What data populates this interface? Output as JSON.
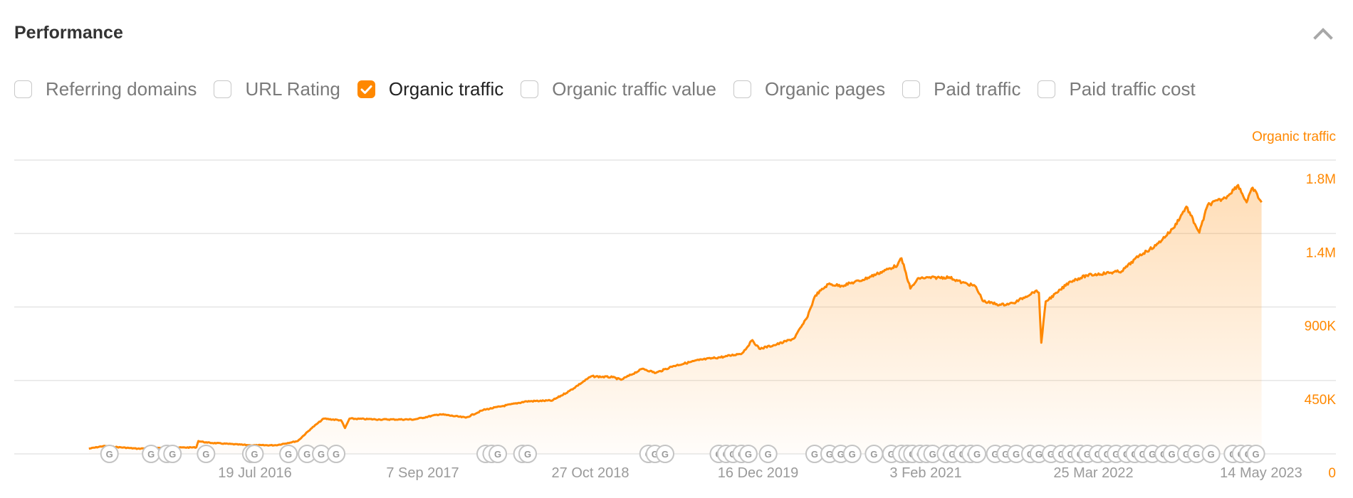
{
  "header": {
    "title": "Performance",
    "collapse_icon": "chevron-up-icon"
  },
  "metrics": [
    {
      "label": "Referring domains",
      "checked": false
    },
    {
      "label": "URL Rating",
      "checked": false
    },
    {
      "label": "Organic traffic",
      "checked": true
    },
    {
      "label": "Organic traffic value",
      "checked": false
    },
    {
      "label": "Organic pages",
      "checked": false
    },
    {
      "label": "Paid traffic",
      "checked": false
    },
    {
      "label": "Paid traffic cost",
      "checked": false
    }
  ],
  "colors": {
    "accent": "#ff8800",
    "grid": "#e6e6e6",
    "axis_text": "#9a9a9a"
  },
  "chart_data": {
    "type": "area",
    "title": "",
    "series_label": "Organic traffic",
    "ylabel": "Organic traffic",
    "y_axis_position": "right",
    "ylim": [
      0,
      1800000
    ],
    "y_ticks": [
      {
        "value": 1800000,
        "label": "1.8M"
      },
      {
        "value": 1350000,
        "label": "1.4M"
      },
      {
        "value": 900000,
        "label": "900K"
      },
      {
        "value": 450000,
        "label": "450K"
      },
      {
        "value": 0,
        "label": "0"
      }
    ],
    "x_ticks": [
      "2016-07-19",
      "2017-09-07",
      "2018-10-27",
      "2019-12-16",
      "2021-02-03",
      "2022-03-25",
      "2023-05-14"
    ],
    "x_tick_labels": [
      "19 Jul 2016",
      "7 Sep 2017",
      "27 Oct 2018",
      "16 Dec 2019",
      "3 Feb 2021",
      "25 Mar 2022",
      "14 May 2023"
    ],
    "grid": true,
    "series": [
      {
        "name": "Organic traffic",
        "points": [
          [
            "2015-06-04",
            32000
          ],
          [
            "2015-07-10",
            48000
          ],
          [
            "2015-10-03",
            32000
          ],
          [
            "2015-11-26",
            37000
          ],
          [
            "2016-02-25",
            40000
          ],
          [
            "2016-03-01",
            79000
          ],
          [
            "2016-03-23",
            69000
          ],
          [
            "2016-07-07",
            53000
          ],
          [
            "2016-09-09",
            53000
          ],
          [
            "2016-11-02",
            79000
          ],
          [
            "2016-12-04",
            153000
          ],
          [
            "2017-01-05",
            216000
          ],
          [
            "2017-02-17",
            206000
          ],
          [
            "2017-02-27",
            158000
          ],
          [
            "2017-03-10",
            216000
          ],
          [
            "2017-05-24",
            211000
          ],
          [
            "2017-08-17",
            211000
          ],
          [
            "2017-10-20",
            243000
          ],
          [
            "2017-12-23",
            222000
          ],
          [
            "2018-02-04",
            269000
          ],
          [
            "2018-03-18",
            290000
          ],
          [
            "2018-05-22",
            322000
          ],
          [
            "2018-07-25",
            327000
          ],
          [
            "2018-09-05",
            385000
          ],
          [
            "2018-10-29",
            475000
          ],
          [
            "2018-12-21",
            470000
          ],
          [
            "2019-01-11",
            454000
          ],
          [
            "2019-03-06",
            522000
          ],
          [
            "2019-04-07",
            496000
          ],
          [
            "2019-05-20",
            538000
          ],
          [
            "2019-07-23",
            575000
          ],
          [
            "2019-09-25",
            596000
          ],
          [
            "2019-11-07",
            617000
          ],
          [
            "2019-12-02",
            697000
          ],
          [
            "2019-12-19",
            644000
          ],
          [
            "2020-01-31",
            670000
          ],
          [
            "2020-03-14",
            707000
          ],
          [
            "2020-04-14",
            829000
          ],
          [
            "2020-05-06",
            971000
          ],
          [
            "2020-06-07",
            1040000
          ],
          [
            "2020-07-09",
            1030000
          ],
          [
            "2020-08-31",
            1066000
          ],
          [
            "2020-11-25",
            1156000
          ],
          [
            "2020-12-05",
            1198000
          ],
          [
            "2020-12-27",
            1013000
          ],
          [
            "2021-01-17",
            1077000
          ],
          [
            "2021-04-02",
            1082000
          ],
          [
            "2021-05-04",
            1050000
          ],
          [
            "2021-06-05",
            1029000
          ],
          [
            "2021-06-26",
            934000
          ],
          [
            "2021-08-08",
            913000
          ],
          [
            "2021-09-09",
            924000
          ],
          [
            "2021-11-01",
            997000
          ],
          [
            "2021-11-10",
            987000
          ],
          [
            "2021-11-16",
            681000
          ],
          [
            "2021-11-27",
            934000
          ],
          [
            "2021-12-25",
            987000
          ],
          [
            "2022-01-26",
            1056000
          ],
          [
            "2022-03-09",
            1093000
          ],
          [
            "2022-06-03",
            1119000
          ],
          [
            "2022-07-16",
            1214000
          ],
          [
            "2022-08-27",
            1277000
          ],
          [
            "2022-10-09",
            1383000
          ],
          [
            "2022-11-10",
            1515000
          ],
          [
            "2022-12-01",
            1409000
          ],
          [
            "2022-12-12",
            1356000
          ],
          [
            "2023-01-02",
            1526000
          ],
          [
            "2023-02-14",
            1568000
          ],
          [
            "2023-03-18",
            1647000
          ],
          [
            "2023-04-08",
            1541000
          ],
          [
            "2023-04-23",
            1631000
          ],
          [
            "2023-05-15",
            1541000
          ]
        ]
      }
    ],
    "annotations": {
      "type": "google-algorithm-updates",
      "icon": "google-g-icon",
      "dates": [
        "2015-07-25",
        "2015-11-05",
        "2015-12-14",
        "2015-12-28",
        "2016-03-20",
        "2016-07-10",
        "2016-07-18",
        "2016-10-10",
        "2016-11-25",
        "2016-12-30",
        "2017-02-05",
        "2018-02-10",
        "2018-02-25",
        "2018-03-12",
        "2018-05-12",
        "2018-05-25",
        "2019-03-20",
        "2019-04-05",
        "2019-04-30",
        "2019-09-10",
        "2019-09-28",
        "2019-10-15",
        "2019-11-05",
        "2019-11-22",
        "2020-01-10",
        "2020-05-04",
        "2020-06-10",
        "2020-07-08",
        "2020-08-05",
        "2020-09-28",
        "2020-11-10",
        "2020-12-05",
        "2020-12-20",
        "2021-01-01",
        "2021-01-20",
        "2021-02-05",
        "2021-02-20",
        "2021-03-25",
        "2021-04-10",
        "2021-05-05",
        "2021-05-25",
        "2021-06-10",
        "2021-07-25",
        "2021-08-20",
        "2021-09-15",
        "2021-10-20",
        "2021-11-10",
        "2021-12-10",
        "2022-01-05",
        "2022-01-28",
        "2022-02-20",
        "2022-03-10",
        "2022-04-05",
        "2022-04-28",
        "2022-05-20",
        "2022-06-15",
        "2022-07-05",
        "2022-07-25",
        "2022-08-18",
        "2022-09-15",
        "2022-10-05",
        "2022-11-10",
        "2022-12-05",
        "2023-01-10",
        "2023-03-05",
        "2023-03-25",
        "2023-04-12",
        "2023-05-01"
      ]
    }
  }
}
